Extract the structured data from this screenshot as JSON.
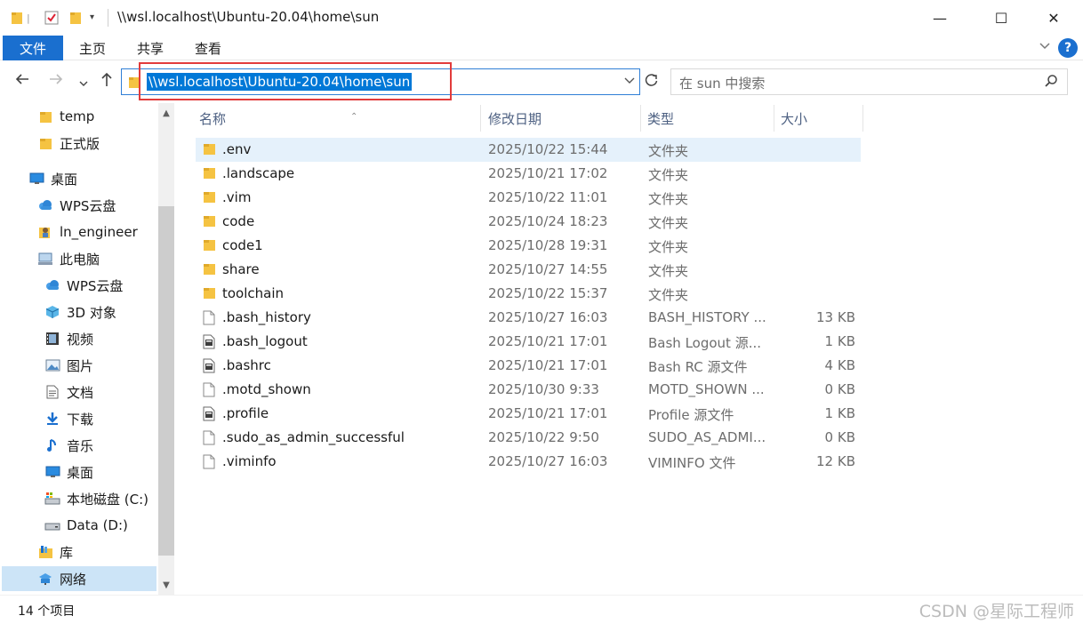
{
  "window": {
    "title": "\\\\wsl.localhost\\Ubuntu-20.04\\home\\sun",
    "minimize": "—",
    "maximize": "☐",
    "close": "✕"
  },
  "ribbon": {
    "tabs": [
      "文件",
      "主页",
      "共享",
      "查看"
    ],
    "help": "?"
  },
  "navigation": {
    "address": "\\\\wsl.localhost\\Ubuntu-20.04\\home\\sun",
    "search_placeholder": "在 sun 中搜索"
  },
  "sidebar": {
    "items": [
      {
        "label": "temp",
        "icon": "folder-icon"
      },
      {
        "label": "正式版",
        "icon": "folder-icon"
      },
      {
        "label": "桌面",
        "icon": "desktop-icon"
      },
      {
        "label": "WPS云盘",
        "icon": "cloud-icon"
      },
      {
        "label": "ln_engineer",
        "icon": "user-folder-icon"
      },
      {
        "label": "此电脑",
        "icon": "computer-icon"
      },
      {
        "label": "WPS云盘",
        "icon": "cloud-icon"
      },
      {
        "label": "3D 对象",
        "icon": "cube-icon"
      },
      {
        "label": "视频",
        "icon": "video-icon"
      },
      {
        "label": "图片",
        "icon": "picture-icon"
      },
      {
        "label": "文档",
        "icon": "document-icon"
      },
      {
        "label": "下载",
        "icon": "download-icon"
      },
      {
        "label": "音乐",
        "icon": "music-icon"
      },
      {
        "label": "桌面",
        "icon": "desktop-icon"
      },
      {
        "label": "本地磁盘 (C:)",
        "icon": "drive-c-icon"
      },
      {
        "label": "Data (D:)",
        "icon": "drive-icon"
      },
      {
        "label": "库",
        "icon": "library-icon"
      },
      {
        "label": "网络",
        "icon": "network-icon",
        "selected": true
      }
    ]
  },
  "columns": {
    "name": "名称",
    "date": "修改日期",
    "type": "类型",
    "size": "大小"
  },
  "files": [
    {
      "name": ".env",
      "date": "2025/10/22 15:44",
      "type": "文件夹",
      "size": "",
      "icon": "folder-icon",
      "selected": true
    },
    {
      "name": ".landscape",
      "date": "2025/10/21 17:02",
      "type": "文件夹",
      "size": "",
      "icon": "folder-icon"
    },
    {
      "name": ".vim",
      "date": "2025/10/22 11:01",
      "type": "文件夹",
      "size": "",
      "icon": "folder-icon"
    },
    {
      "name": "code",
      "date": "2025/10/24 18:23",
      "type": "文件夹",
      "size": "",
      "icon": "folder-icon"
    },
    {
      "name": "code1",
      "date": "2025/10/28 19:31",
      "type": "文件夹",
      "size": "",
      "icon": "folder-icon"
    },
    {
      "name": "share",
      "date": "2025/10/27 14:55",
      "type": "文件夹",
      "size": "",
      "icon": "folder-icon"
    },
    {
      "name": "toolchain",
      "date": "2025/10/22 15:37",
      "type": "文件夹",
      "size": "",
      "icon": "folder-icon"
    },
    {
      "name": ".bash_history",
      "date": "2025/10/27 16:03",
      "type": "BASH_HISTORY ...",
      "size": "13 KB",
      "icon": "file-icon"
    },
    {
      "name": ".bash_logout",
      "date": "2025/10/21 17:01",
      "type": "Bash Logout 源...",
      "size": "1 KB",
      "icon": "script-file-icon"
    },
    {
      "name": ".bashrc",
      "date": "2025/10/21 17:01",
      "type": "Bash RC 源文件",
      "size": "4 KB",
      "icon": "script-file-icon"
    },
    {
      "name": ".motd_shown",
      "date": "2025/10/30 9:33",
      "type": "MOTD_SHOWN ...",
      "size": "0 KB",
      "icon": "file-icon"
    },
    {
      "name": ".profile",
      "date": "2025/10/21 17:01",
      "type": "Profile 源文件",
      "size": "1 KB",
      "icon": "script-file-icon"
    },
    {
      "name": ".sudo_as_admin_successful",
      "date": "2025/10/22 9:50",
      "type": "SUDO_AS_ADMI...",
      "size": "0 KB",
      "icon": "file-icon"
    },
    {
      "name": ".viminfo",
      "date": "2025/10/27 16:03",
      "type": "VIMINFO 文件",
      "size": "12 KB",
      "icon": "file-icon"
    }
  ],
  "status": {
    "count": "14 个项目",
    "watermark": "CSDN @星际工程师"
  },
  "colors": {
    "accent": "#1a6fcf",
    "selection": "#cce4f7",
    "row_hover": "#e5f1fb",
    "annotation": "#e23b3b",
    "folder": "#f5c342"
  }
}
